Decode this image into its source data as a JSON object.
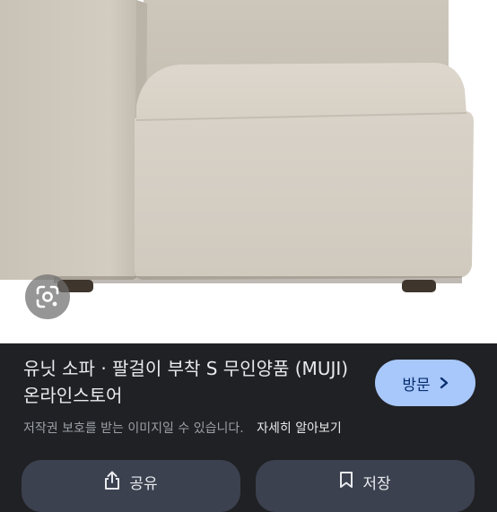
{
  "result": {
    "title": "유닛 소파 · 팔걸이 부착 S 무인양품 (MUJI) 온라인스토어",
    "visit_label": "방문",
    "copyright_notice": "저작권 보호를 받는 이미지일 수 있습니다.",
    "learn_more": "자세히 알아보기"
  },
  "actions": {
    "share_label": "공유",
    "save_label": "저장"
  },
  "icons": {
    "lens": "google-lens-icon",
    "visit": "chevron-right-icon",
    "share": "share-icon",
    "save": "bookmark-icon"
  },
  "colors": {
    "panel_bg": "#202124",
    "visit_btn_bg": "#a8c7fa",
    "action_btn_bg": "#3c4150",
    "sofa_fabric": "#d8d2c7"
  }
}
